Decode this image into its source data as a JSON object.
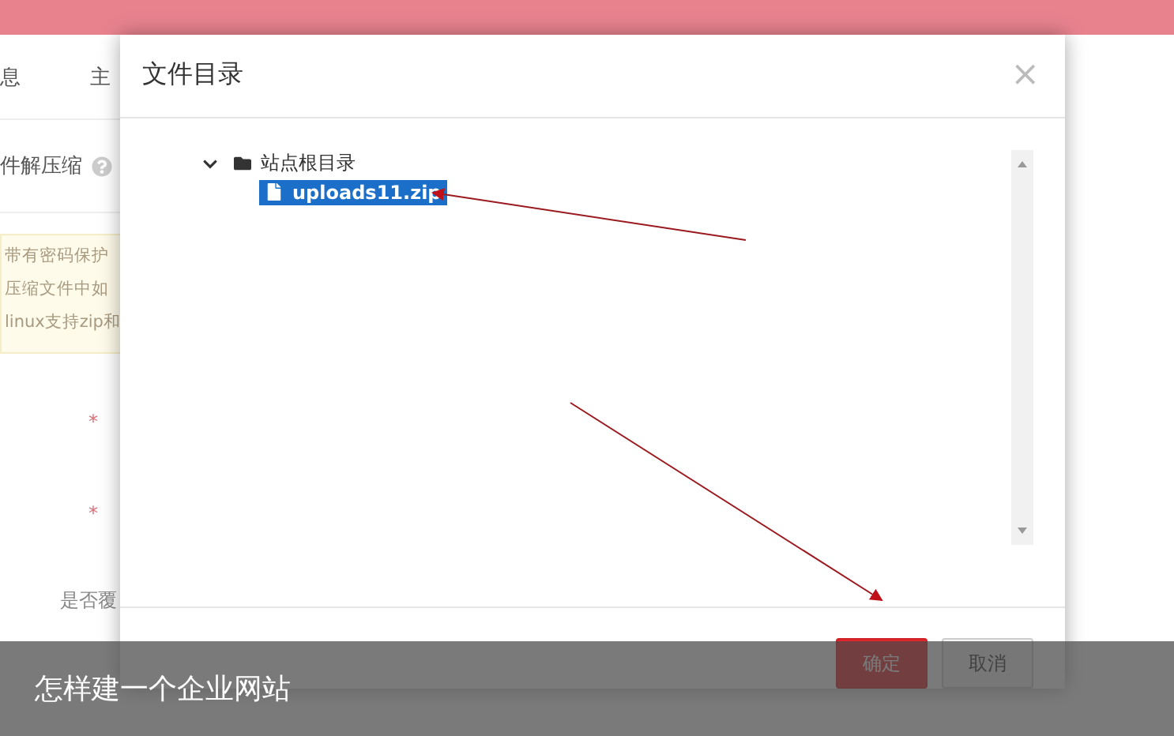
{
  "page": {
    "tabs": [
      {
        "label": "息"
      },
      {
        "label": "主"
      }
    ],
    "section_title": "件解压缩",
    "notice_lines": [
      "带有密码保护",
      "压缩文件中如",
      "linux支持zip和"
    ],
    "field_markers": [
      "*",
      "*"
    ],
    "overwrite_label": "是否覆"
  },
  "dialog": {
    "title": "文件目录",
    "close": "×",
    "tree": [
      {
        "label": "站点根目录",
        "kind": "folder",
        "expanded": true,
        "selected": false,
        "children": [
          {
            "label": "uploads11.zip",
            "kind": "file",
            "selected": true
          }
        ]
      }
    ],
    "buttons": [
      {
        "label": "确定",
        "primary": true
      },
      {
        "label": "取消",
        "primary": false
      }
    ]
  },
  "caption": "怎样建一个企业网站"
}
